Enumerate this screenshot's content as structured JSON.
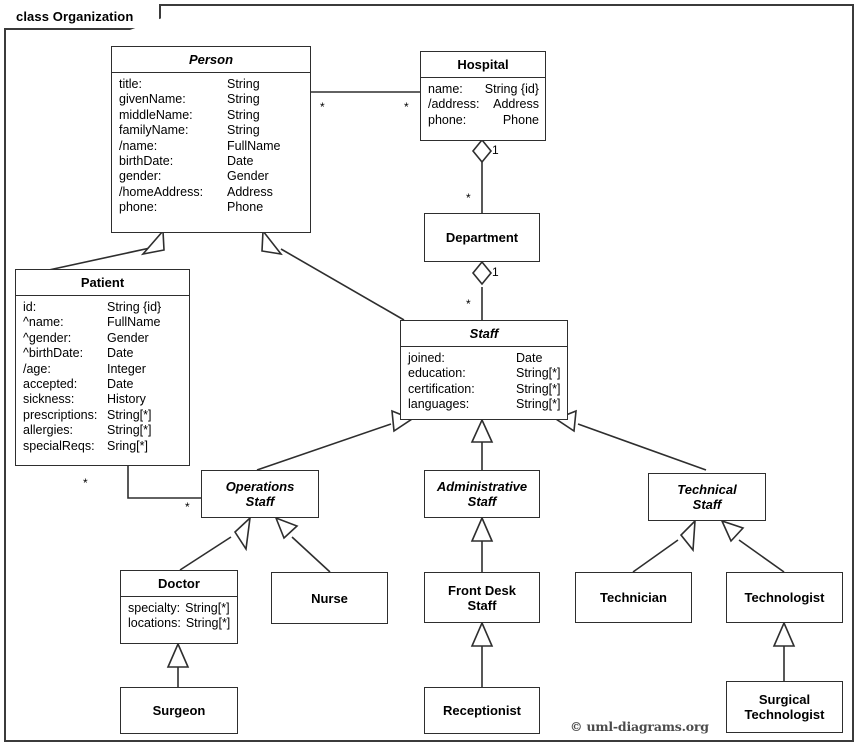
{
  "frame": {
    "tab_label": "class Organization"
  },
  "credit": "© uml-diagrams.org",
  "classes": {
    "person": {
      "name": "Person",
      "abstract": true,
      "attrs": [
        {
          "n": "title:",
          "t": "String"
        },
        {
          "n": "givenName:",
          "t": "String"
        },
        {
          "n": "middleName:",
          "t": "String"
        },
        {
          "n": "familyName:",
          "t": "String"
        },
        {
          "n": "/name:",
          "t": "FullName"
        },
        {
          "n": "birthDate:",
          "t": "Date"
        },
        {
          "n": "gender:",
          "t": "Gender"
        },
        {
          "n": "/homeAddress:",
          "t": "Address"
        },
        {
          "n": "phone:",
          "t": "Phone"
        }
      ]
    },
    "hospital": {
      "name": "Hospital",
      "abstract": false,
      "attrs": [
        {
          "n": "name:",
          "t": "String {id}"
        },
        {
          "n": "/address:",
          "t": "Address"
        },
        {
          "n": "phone:",
          "t": "Phone"
        }
      ]
    },
    "patient": {
      "name": "Patient",
      "abstract": false,
      "attrs": [
        {
          "n": "id:",
          "t": "String {id}"
        },
        {
          "n": "^name:",
          "t": "FullName"
        },
        {
          "n": "^gender:",
          "t": "Gender"
        },
        {
          "n": "^birthDate:",
          "t": "Date"
        },
        {
          "n": "/age:",
          "t": "Integer"
        },
        {
          "n": "accepted:",
          "t": "Date"
        },
        {
          "n": "sickness:",
          "t": "History"
        },
        {
          "n": "prescriptions:",
          "t": "String[*]"
        },
        {
          "n": "allergies:",
          "t": "String[*]"
        },
        {
          "n": "specialReqs:",
          "t": "Sring[*]"
        }
      ]
    },
    "department": {
      "name": "Department",
      "abstract": false,
      "attrs": []
    },
    "staff": {
      "name": "Staff",
      "abstract": true,
      "attrs": [
        {
          "n": "joined:",
          "t": "Date"
        },
        {
          "n": "education:",
          "t": "String[*]"
        },
        {
          "n": "certification:",
          "t": "String[*]"
        },
        {
          "n": "languages:",
          "t": "String[*]"
        }
      ]
    },
    "operations_staff": {
      "name": "Operations\nStaff",
      "abstract": true,
      "attrs": []
    },
    "administrative_staff": {
      "name": "Administrative\nStaff",
      "abstract": true,
      "attrs": []
    },
    "technical_staff": {
      "name": "Technical\nStaff",
      "abstract": true,
      "attrs": []
    },
    "doctor": {
      "name": "Doctor",
      "abstract": false,
      "attrs": [
        {
          "n": "specialty:",
          "t": "String[*]"
        },
        {
          "n": "locations:",
          "t": "String[*]"
        }
      ]
    },
    "nurse": {
      "name": "Nurse",
      "abstract": false,
      "attrs": []
    },
    "front_desk_staff": {
      "name": "Front Desk\nStaff",
      "abstract": false,
      "attrs": []
    },
    "technician": {
      "name": "Technician",
      "abstract": false,
      "attrs": []
    },
    "technologist": {
      "name": "Technologist",
      "abstract": false,
      "attrs": []
    },
    "surgeon": {
      "name": "Surgeon",
      "abstract": false,
      "attrs": []
    },
    "receptionist": {
      "name": "Receptionist",
      "abstract": false,
      "attrs": []
    },
    "surgical_technologist": {
      "name": "Surgical\nTechnologist",
      "abstract": false,
      "attrs": []
    }
  },
  "multiplicities": {
    "person_hospital_source": "*",
    "person_hospital_target": "*",
    "hospital_department_whole": "1",
    "hospital_department_part": "*",
    "department_staff_whole": "1",
    "department_staff_part": "*",
    "patient_operations_source": "*",
    "patient_operations_target": "*"
  },
  "relationships": [
    {
      "kind": "association",
      "from": "person",
      "to": "hospital"
    },
    {
      "kind": "aggregation",
      "from": "hospital",
      "to": "department"
    },
    {
      "kind": "aggregation",
      "from": "department",
      "to": "staff"
    },
    {
      "kind": "association",
      "from": "patient",
      "to": "operations_staff"
    },
    {
      "kind": "generalization",
      "from": "patient",
      "to": "person"
    },
    {
      "kind": "generalization",
      "from": "staff",
      "to": "person"
    },
    {
      "kind": "generalization",
      "from": "operations_staff",
      "to": "staff"
    },
    {
      "kind": "generalization",
      "from": "administrative_staff",
      "to": "staff"
    },
    {
      "kind": "generalization",
      "from": "technical_staff",
      "to": "staff"
    },
    {
      "kind": "generalization",
      "from": "doctor",
      "to": "operations_staff"
    },
    {
      "kind": "generalization",
      "from": "nurse",
      "to": "operations_staff"
    },
    {
      "kind": "generalization",
      "from": "front_desk_staff",
      "to": "administrative_staff"
    },
    {
      "kind": "generalization",
      "from": "technician",
      "to": "technical_staff"
    },
    {
      "kind": "generalization",
      "from": "technologist",
      "to": "technical_staff"
    },
    {
      "kind": "generalization",
      "from": "surgeon",
      "to": "doctor"
    },
    {
      "kind": "generalization",
      "from": "receptionist",
      "to": "front_desk_staff"
    },
    {
      "kind": "generalization",
      "from": "surgical_technologist",
      "to": "technologist"
    }
  ]
}
